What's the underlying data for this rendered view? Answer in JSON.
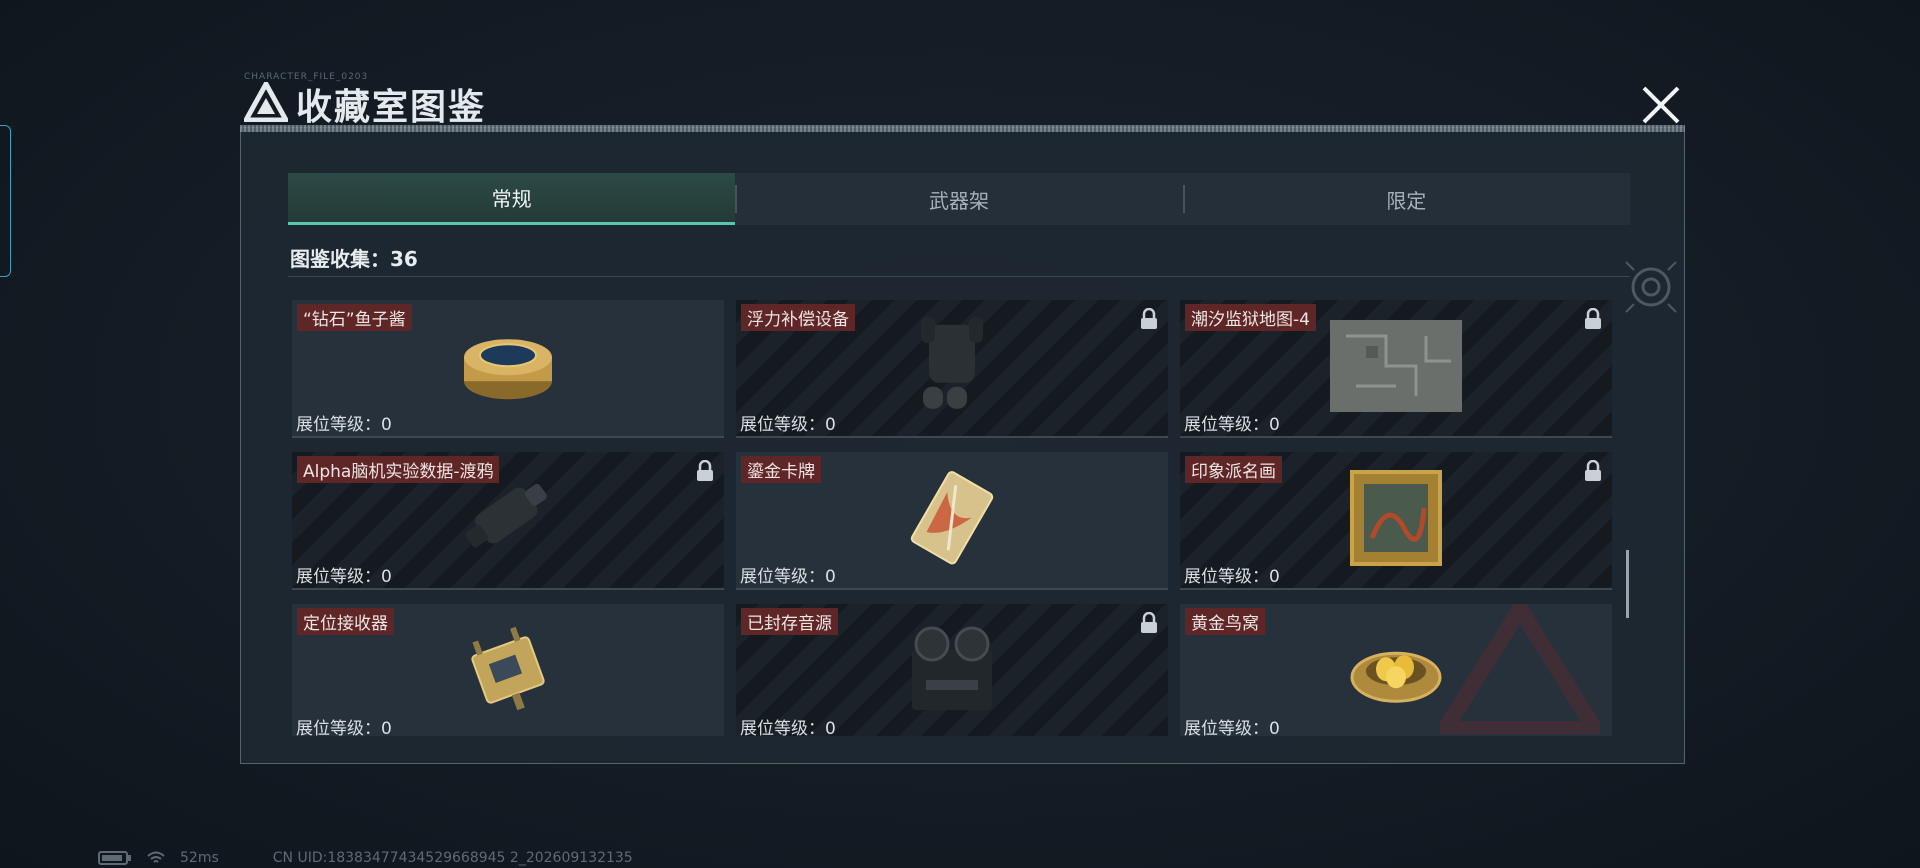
{
  "window": {
    "title": "收藏室图鉴",
    "tiny_caption": "CHARACTER_FILE_0203"
  },
  "tabs": [
    {
      "label": "常规",
      "active": true
    },
    {
      "label": "武器架",
      "active": false
    },
    {
      "label": "限定",
      "active": false
    }
  ],
  "collection": {
    "label": "图鉴收集：36"
  },
  "items": [
    {
      "name": "“钻石”鱼子酱",
      "level": "展位等级：0",
      "locked": false,
      "icon": "caviar-tin-icon"
    },
    {
      "name": "浮力补偿设备",
      "level": "展位等级：0",
      "locked": true,
      "icon": "buoyancy-vest-icon"
    },
    {
      "name": "潮汐监狱地图-4",
      "level": "展位等级：0",
      "locked": true,
      "icon": "prison-map-icon"
    },
    {
      "name": "Alpha脑机实验数据-渡鸦",
      "level": "展位等级：0",
      "locked": true,
      "icon": "data-device-icon"
    },
    {
      "name": "鎏金卡牌",
      "level": "展位等级：0",
      "locked": false,
      "icon": "golden-card-icon"
    },
    {
      "name": "印象派名画",
      "level": "展位等级：0",
      "locked": true,
      "icon": "painting-icon"
    },
    {
      "name": "定位接收器",
      "level": "展位等级：0",
      "locked": false,
      "icon": "locator-receiver-icon"
    },
    {
      "name": "已封存音源",
      "level": "展位等级：0",
      "locked": true,
      "icon": "tape-recorder-icon"
    },
    {
      "name": "黄金鸟窝",
      "level": "展位等级：0",
      "locked": false,
      "icon": "golden-nest-icon"
    }
  ],
  "status_bar": {
    "ping": "52ms",
    "uid": "CN UID:18383477434529668945 2_202609132135"
  },
  "colors": {
    "accent": "#58c7ae",
    "name_tag": "#5e2626",
    "panel": "#1e2832"
  }
}
